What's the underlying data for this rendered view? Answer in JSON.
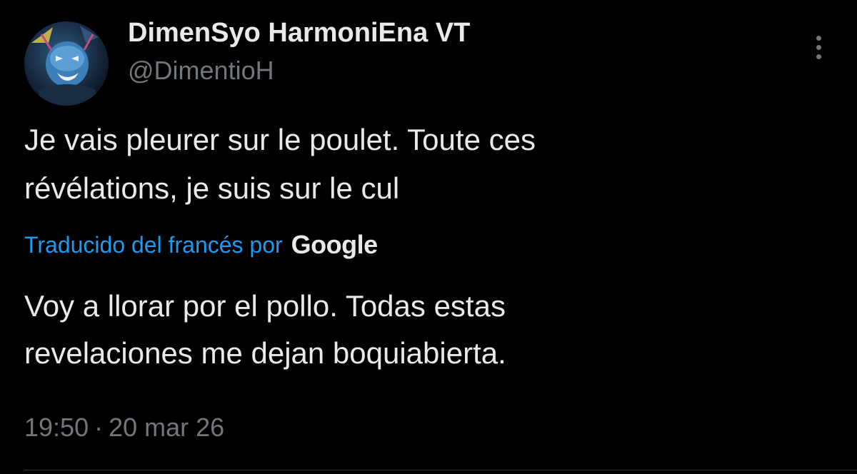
{
  "user": {
    "display_name": "DimenSyo HarmoniEna VT",
    "handle": "@DimentioH",
    "avatar_icon": "profile-avatar"
  },
  "more_icon": "more-options-vertical-icon",
  "tweet": {
    "lines": [
      "Je vais pleurer sur le poulet. Toute ces",
      "révélations, je suis sur le cul"
    ]
  },
  "translation": {
    "label": "Traducido del francés por",
    "provider": "Google",
    "lines": [
      "Voy a llorar por el pollo. Todas estas",
      "revelaciones me dejan boquiabierta."
    ]
  },
  "meta": {
    "time": "19:50",
    "separator": "·",
    "date": "20 mar 26"
  },
  "colors": {
    "background": "#000000",
    "primary_text": "#e7e9ea",
    "secondary_text": "#71767b",
    "link": "#1d9bf0",
    "divider": "#2f3336"
  }
}
